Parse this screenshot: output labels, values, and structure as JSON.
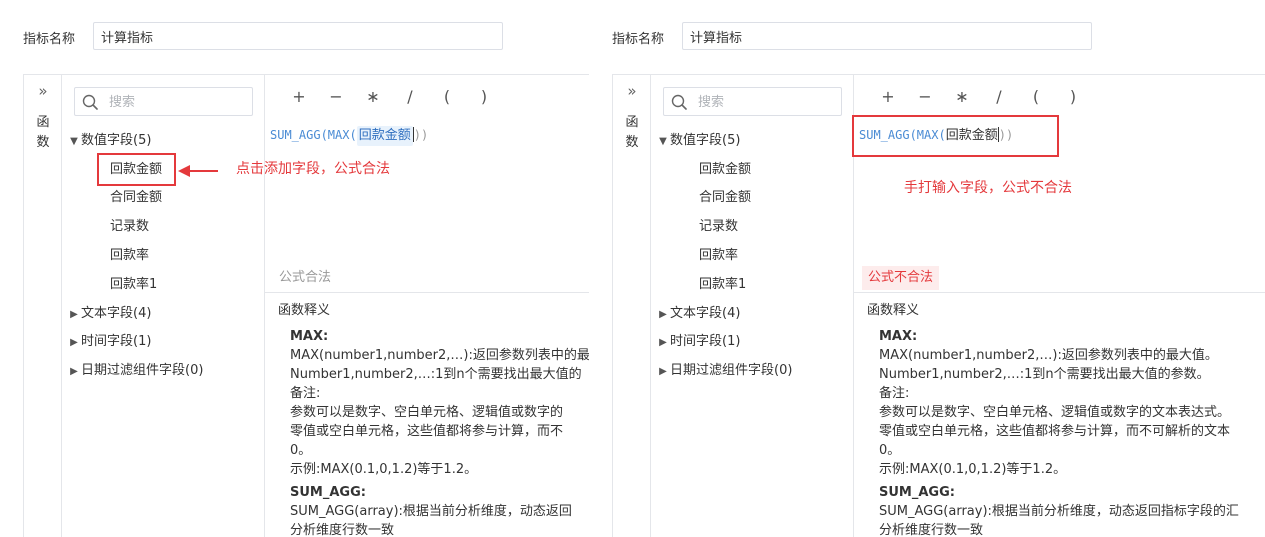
{
  "left": {
    "name_label": "指标名称",
    "name_value": "计算指标",
    "fn_tab": [
      "函",
      "数"
    ],
    "search_placeholder": "搜索",
    "groups": {
      "numeric": "数值字段(5)",
      "text": "文本字段(4)",
      "time": "时间字段(1)",
      "date_filter": "日期过滤组件字段(0)"
    },
    "numeric_items": [
      "回款金额",
      "合同金额",
      "记录数",
      "回款率",
      "回款率1"
    ],
    "operators": [
      "+",
      "−",
      "∗",
      "/",
      "(",
      ")"
    ],
    "formula": {
      "prefix": "SUM_AGG(MAX(",
      "field": "回款金额",
      "suffix": "))"
    },
    "status": "公式合法",
    "desc_title": "函数释义",
    "desc_lines": [
      "MAX:",
      "MAX(number1,number2,…):返回参数列表中的最",
      "Number1,number2,…:1到n个需要找出最大值的",
      "备注:",
      "参数可以是数字、空白单元格、逻辑值或数字的",
      "零值或空白单元格，这些值都将参与计算，而不",
      "0。",
      "示例:MAX(0.1,0,1.2)等于1.2。",
      "SUM_AGG:",
      "SUM_AGG(array):根据当前分析维度，动态返回",
      "分析维度行数一致"
    ],
    "annotation": "点击添加字段，公式合法"
  },
  "right": {
    "name_label": "指标名称",
    "name_value": "计算指标",
    "fn_tab": [
      "函",
      "数"
    ],
    "search_placeholder": "搜索",
    "groups": {
      "numeric": "数值字段(5)",
      "text": "文本字段(4)",
      "time": "时间字段(1)",
      "date_filter": "日期过滤组件字段(0)"
    },
    "numeric_items": [
      "回款金额",
      "合同金额",
      "记录数",
      "回款率",
      "回款率1"
    ],
    "operators": [
      "+",
      "−",
      "∗",
      "/",
      "(",
      ")"
    ],
    "formula": {
      "prefix": "SUM_AGG(MAX(",
      "field": "回款金额",
      "suffix": "))"
    },
    "status": "公式不合法",
    "desc_title": "函数释义",
    "desc_lines": [
      "MAX:",
      "MAX(number1,number2,…):返回参数列表中的最大值。",
      "Number1,number2,…:1到n个需要找出最大值的参数。",
      "备注:",
      "参数可以是数字、空白单元格、逻辑值或数字的文本表达式。",
      "零值或空白单元格，这些值都将参与计算，而不可解析的文本",
      "0。",
      "示例:MAX(0.1,0,1.2)等于1.2。",
      "SUM_AGG:",
      "SUM_AGG(array):根据当前分析维度，动态返回指标字段的汇",
      "分析维度行数一致"
    ],
    "annotation": "手打输入字段，公式不合法"
  },
  "colors": {
    "highlight": "#e4393c",
    "formula_blue": "#4a8bd4",
    "chip_bg": "#e8f2fc"
  }
}
